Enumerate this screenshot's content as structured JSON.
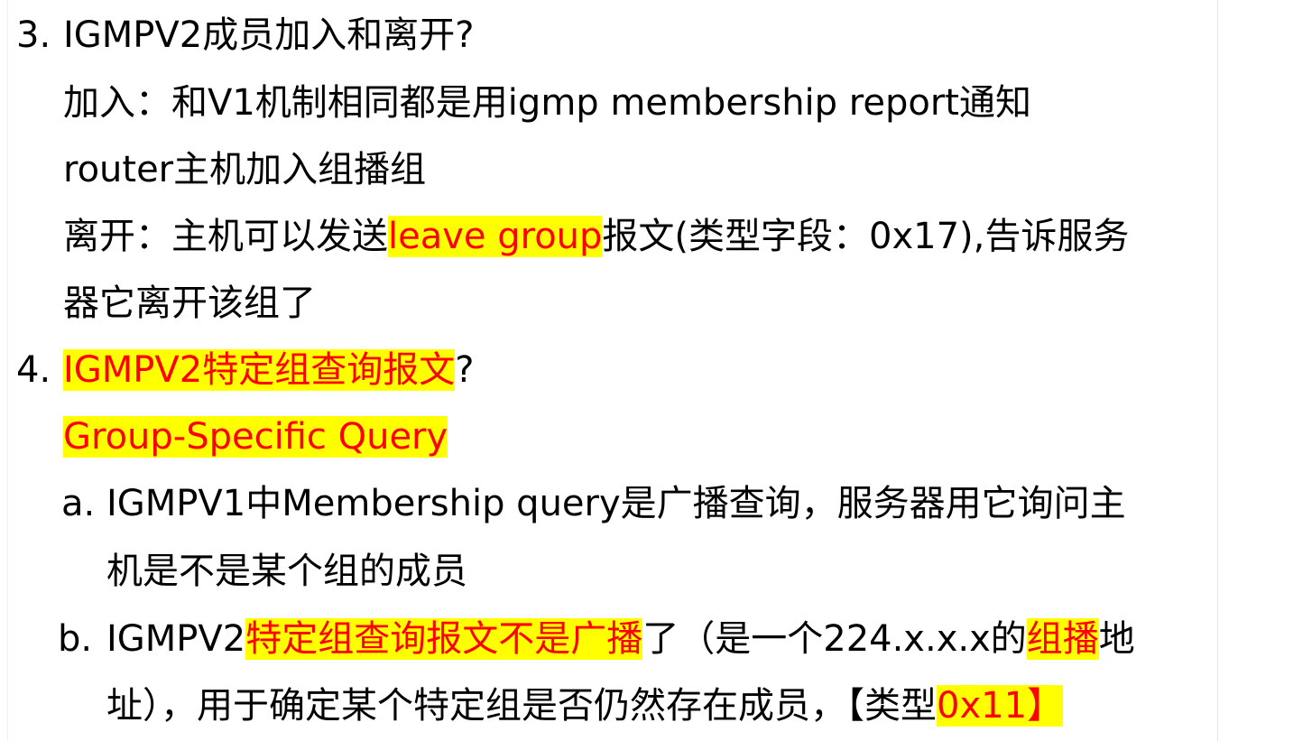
{
  "section3": {
    "number": "3.",
    "title": "IGMPV2成员加入和离开?",
    "join_line1": "加入：和V1机制相同都是用igmp membership report通知",
    "join_line2": "router主机加入组播组",
    "leave_prefix": "离开：主机可以发送",
    "leave_highlight": "leave group",
    "leave_suffix": "报文(类型字段：0x17),告诉服务",
    "leave_line2": "器它离开该组了"
  },
  "section4": {
    "number": "4.",
    "title_highlight": "IGMPV2特定组查询报文",
    "title_suffix": "?",
    "subtitle_highlight": "Group-Specific Query",
    "item_a": {
      "marker": "a.",
      "line1": "IGMPV1中Membership query是广播查询，服务器用它询问主",
      "line2": "机是不是某个组的成员"
    },
    "item_b": {
      "marker": "b.",
      "line1_prefix": "IGMPV2",
      "line1_highlight1": "特定组查询报文不是广播",
      "line1_middle": "了（是一个224.x.x.x的",
      "line1_highlight2": "组播",
      "line1_suffix": "地",
      "line2_prefix": "址），用于确定某个特定组是否仍然存在成员，【类型",
      "line2_highlight": "0x11】"
    }
  },
  "colors": {
    "highlight_background": "#ffff00",
    "highlight_text": "#ff0000",
    "body_text": "#000000"
  }
}
